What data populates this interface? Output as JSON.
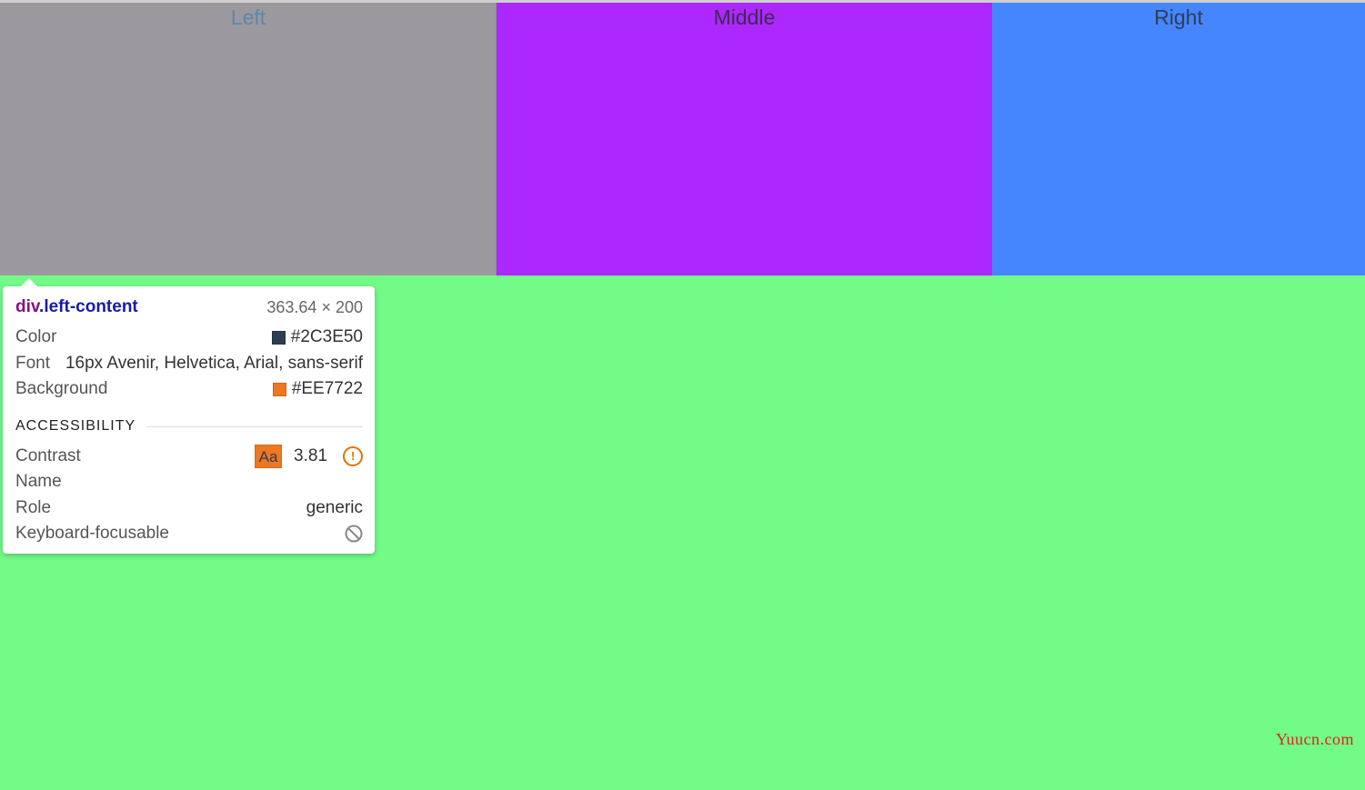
{
  "panels": {
    "left_label": "Left",
    "middle_label": "Middle",
    "right_label": "Right"
  },
  "colors": {
    "left_bg": "#9B999D",
    "middle_bg": "#AD27FF",
    "right_bg": "#4586FF",
    "content_bg": "#73FB87"
  },
  "tooltip": {
    "tag": "div",
    "class_name": ".left-content",
    "size": "363.64 × 200",
    "color_label": "Color",
    "color_value": "#2C3E50",
    "font_label": "Font",
    "font_value": "16px Avenir, Helvetica, Arial, sans-serif",
    "background_label": "Background",
    "background_value": "#EE7722",
    "section_title": "ACCESSIBILITY",
    "contrast_label": "Contrast",
    "contrast_sample": "Aa",
    "contrast_value": "3.81",
    "contrast_icon": "warning-icon",
    "name_label": "Name",
    "name_value": "",
    "role_label": "Role",
    "role_value": "generic",
    "keyboard_label": "Keyboard-focusable",
    "keyboard_icon": "not-focusable-icon"
  },
  "watermark": "Yuucn.com"
}
